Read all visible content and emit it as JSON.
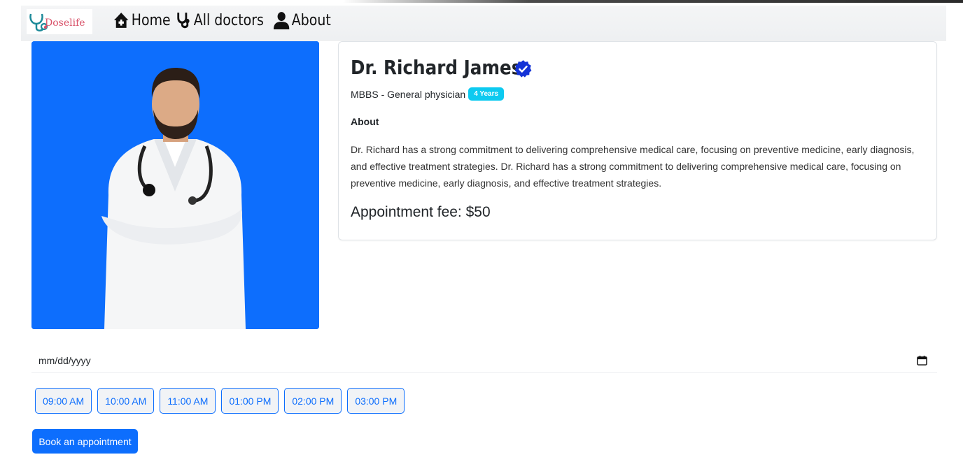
{
  "brand": {
    "logo_text": "Doselife",
    "accent": "#0d6efd"
  },
  "nav": {
    "items": [
      {
        "label": "Home",
        "icon": "house-medical-icon"
      },
      {
        "label": "All doctors",
        "icon": "stethoscope-icon"
      },
      {
        "label": "About",
        "icon": "user-icon"
      }
    ]
  },
  "doctor": {
    "name": "Dr. Richard James",
    "verified_icon": "verified-badge-icon",
    "credentials": "MBBS - General physician",
    "experience_badge": "4 Years",
    "about_title": "About",
    "about_text": "Dr. Richard has a strong commitment to delivering comprehensive medical care, focusing on preventive medicine, early diagnosis, and effective treatment strategies. Dr. Richard has a strong commitment to delivering comprehensive medical care, focusing on preventive medicine, early diagnosis, and effective treatment strategies.",
    "fee_label": "Appointment fee: $50"
  },
  "booking": {
    "date_placeholder": "mm/dd/yyyy",
    "slots": [
      "09:00 AM",
      "10:00 AM",
      "11:00 AM",
      "01:00 PM",
      "02:00 PM",
      "03:00 PM"
    ],
    "book_label": "Book an appointment"
  }
}
